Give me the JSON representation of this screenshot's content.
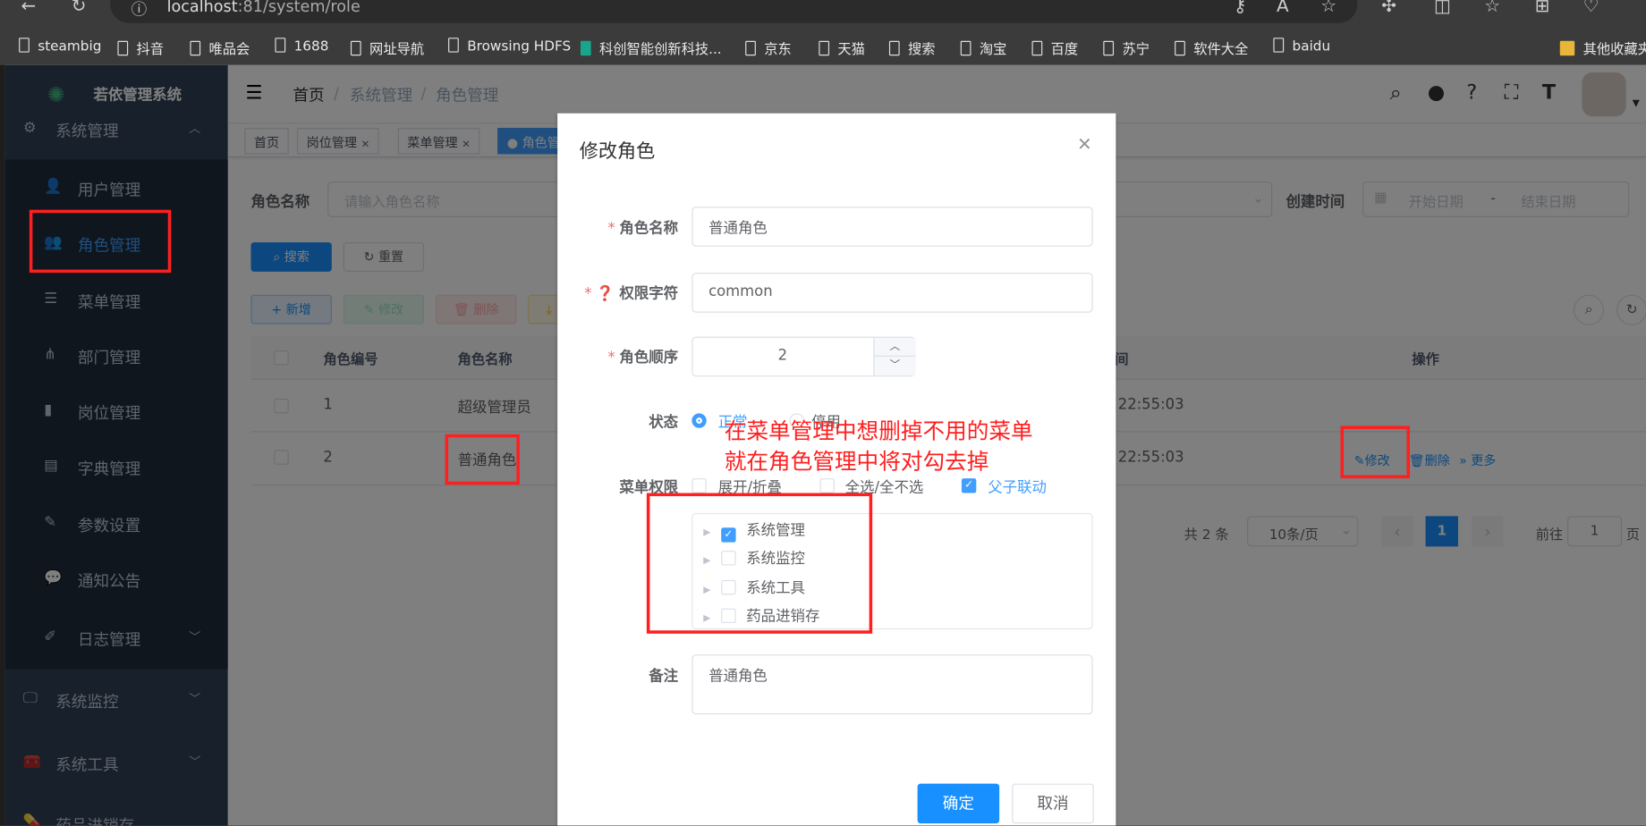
{
  "browser": {
    "url_host": "localhost",
    "url_path": ":81/system/role",
    "bookmarks": [
      "steambig",
      "抖音",
      "唯品会",
      "1688",
      "网址导航",
      "Browsing HDFS",
      "科创智能创新科技...",
      "京东",
      "天猫",
      "搜索",
      "淘宝",
      "百度",
      "苏宁",
      "软件大全",
      "baidu"
    ],
    "other_bookmarks": "其他收藏夹"
  },
  "sidebar": {
    "logo": "若依管理系统",
    "group": "系统管理",
    "items": [
      {
        "label": "用户管理",
        "icon": "user-icon"
      },
      {
        "label": "角色管理",
        "icon": "peoples-icon"
      },
      {
        "label": "菜单管理",
        "icon": "tree-table-icon"
      },
      {
        "label": "部门管理",
        "icon": "tree-icon"
      },
      {
        "label": "岗位管理",
        "icon": "post-icon"
      },
      {
        "label": "字典管理",
        "icon": "dict-icon"
      },
      {
        "label": "参数设置",
        "icon": "edit-icon"
      },
      {
        "label": "通知公告",
        "icon": "message-icon"
      },
      {
        "label": "日志管理",
        "icon": "log-icon"
      }
    ],
    "groups": [
      "系统监控",
      "系统工具",
      "药品进销存"
    ],
    "active_color": "#409eff"
  },
  "navbar": {
    "breadcrumb": [
      "首页",
      "系统管理",
      "角色管理"
    ]
  },
  "tags": [
    {
      "label": "首页"
    },
    {
      "label": "岗位管理"
    },
    {
      "label": "菜单管理"
    },
    {
      "label": "角色管理"
    }
  ],
  "search": {
    "role_name_label": "角色名称",
    "role_name_placeholder": "请输入角色名称",
    "created_label": "创建时间",
    "start_placeholder": "开始日期",
    "end_placeholder": "结束日期",
    "date_sep": "-",
    "search_btn": "搜索",
    "reset_btn": "重置"
  },
  "toolbar": {
    "add": "新增",
    "edit": "修改",
    "delete": "删除"
  },
  "table": {
    "headers": [
      "角色编号",
      "角色名称",
      "间",
      "操作"
    ],
    "rows": [
      {
        "id": "1",
        "name": "超级管理员",
        "time": "22:55:03"
      },
      {
        "id": "2",
        "name": "普通角色",
        "time": "22:55:03",
        "actions": [
          "修改",
          "删除",
          "更多"
        ]
      }
    ]
  },
  "pagination": {
    "total": "共 2 条",
    "page_size": "10条/页",
    "current": "1",
    "goto_label": "前往",
    "goto_value": "1",
    "page_suffix": "页"
  },
  "dialog": {
    "title": "修改角色",
    "role_name_label": "角色名称",
    "role_name": "普通角色",
    "role_key_label": "权限字符",
    "role_key": "common",
    "role_sort_label": "角色顺序",
    "role_sort": "2",
    "status_label": "状态",
    "status_options": [
      "正常",
      "停用"
    ],
    "status_selected": "正常",
    "menu_label": "菜单权限",
    "menu_opts": [
      {
        "label": "展开/折叠",
        "checked": false
      },
      {
        "label": "全选/全不选",
        "checked": false
      },
      {
        "label": "父子联动",
        "checked": true
      }
    ],
    "tree": [
      {
        "label": "系统管理",
        "checked": true
      },
      {
        "label": "系统监控",
        "checked": false
      },
      {
        "label": "系统工具",
        "checked": false
      },
      {
        "label": "药品进销存",
        "checked": false
      }
    ],
    "remark_label": "备注",
    "remark": "普通角色",
    "confirm": "确定",
    "cancel": "取消"
  },
  "annotation": {
    "line1": "在菜单管理中想删掉不用的菜单",
    "line2": "就在角色管理中将对勾去掉"
  }
}
